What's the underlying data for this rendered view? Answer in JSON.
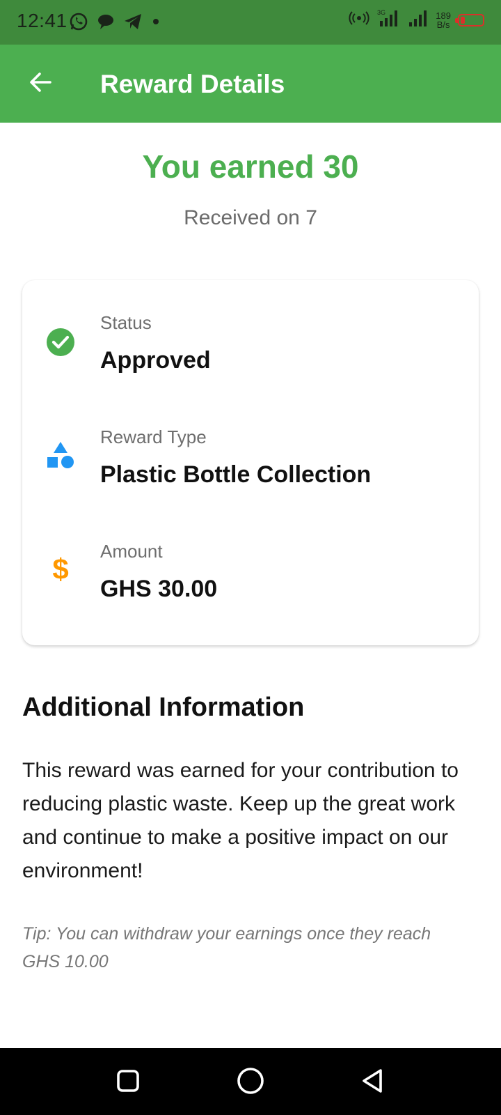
{
  "status_bar": {
    "time": "12:41",
    "net_speed_value": "189",
    "net_speed_unit": "B/s",
    "network_type": "3G"
  },
  "app_bar": {
    "title": "Reward Details",
    "back_icon": "arrow-left-icon"
  },
  "header": {
    "earned_text": "You earned 30",
    "received_text": "Received on 7"
  },
  "details": [
    {
      "label": "Status",
      "value": "Approved",
      "icon": "check-circle-icon",
      "icon_color": "#4caf50"
    },
    {
      "label": "Reward Type",
      "value": "Plastic Bottle Collection",
      "icon": "category-shapes-icon",
      "icon_color": "#2196f3"
    },
    {
      "label": "Amount",
      "value": "GHS 30.00",
      "icon": "dollar-icon",
      "icon_color": "#ff9800"
    }
  ],
  "additional": {
    "title": "Additional Information",
    "body": "This reward was earned for your contribution to reducing plastic waste. Keep up the great work and continue to make a positive impact on our environment!",
    "tip": "Tip: You can withdraw your earnings once they reach GHS 10.00"
  },
  "colors": {
    "primary": "#4caf50",
    "status_bar": "#3f8a3c"
  }
}
